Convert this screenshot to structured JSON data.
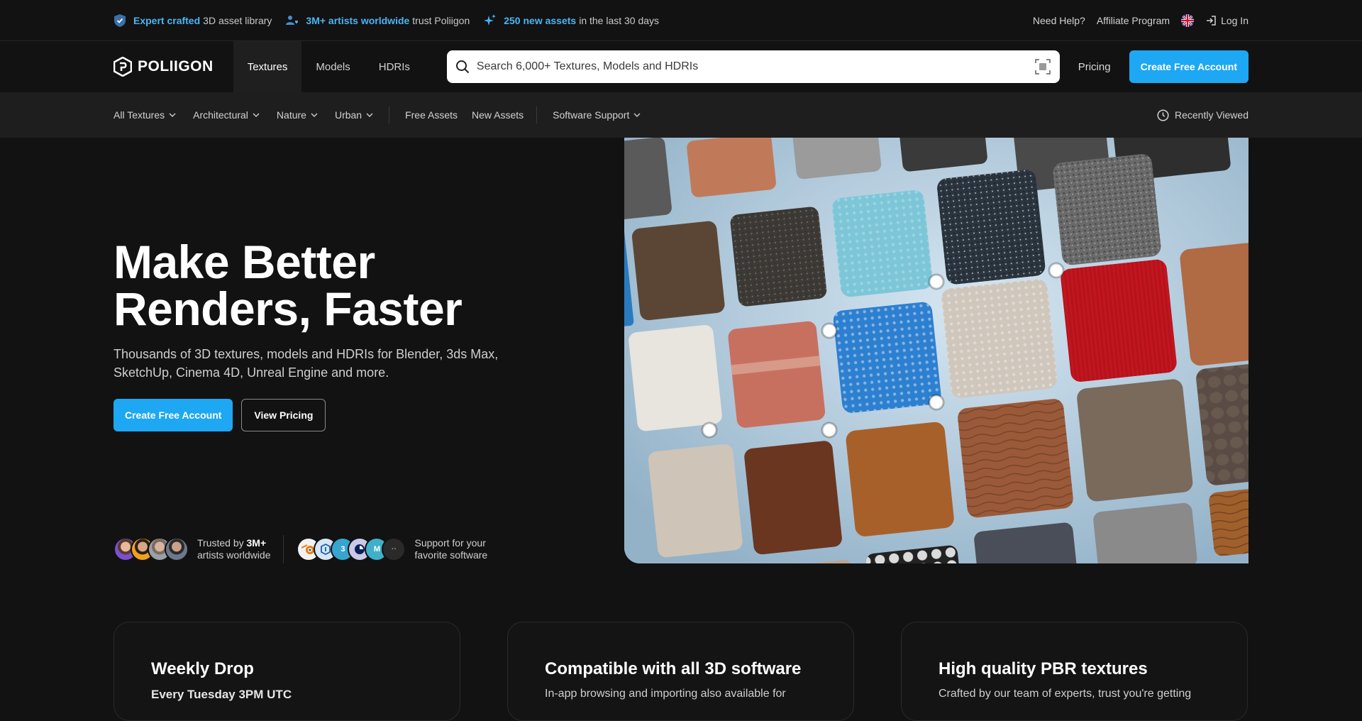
{
  "topbar": {
    "item1_hl": "Expert crafted",
    "item1_text": "3D asset library",
    "item2_hl": "3M+ artists worldwide",
    "item2_text": "trust Poliigon",
    "item3_hl": "250 new assets",
    "item3_text": "in the last 30 days",
    "help": "Need Help?",
    "affiliate": "Affiliate Program",
    "login": "Log In"
  },
  "header": {
    "logo": "POLIIGON",
    "tabs": [
      "Textures",
      "Models",
      "HDRIs"
    ],
    "search_placeholder": "Search 6,000+ Textures, Models and HDRIs",
    "pricing": "Pricing",
    "cta": "Create Free Account"
  },
  "catbar": {
    "dropdowns": [
      "All Textures",
      "Architectural",
      "Nature",
      "Urban"
    ],
    "links": [
      "Free Assets",
      "New Assets"
    ],
    "software": "Software Support",
    "recent": "Recently Viewed"
  },
  "hero": {
    "title_line1": "Make Better",
    "title_line2": "Renders, Faster",
    "subtitle": "Thousands of 3D textures, models and HDRIs for Blender, 3ds Max, SketchUp, Cinema 4D, Unreal Engine and more.",
    "cta_primary": "Create Free Account",
    "cta_secondary": "View Pricing",
    "trust_prefix": "Trusted by",
    "trust_count": "3M+",
    "trust_suffix": "artists worldwide",
    "support_line1": "Support for your",
    "support_line2": "favorite software",
    "software_badges": [
      "3",
      "M",
      "··"
    ]
  },
  "cards": [
    {
      "title": "Weekly Drop",
      "text": "Every Tuesday 3PM UTC"
    },
    {
      "title": "Compatible with all 3D software",
      "text": "In-app browsing and importing also available for"
    },
    {
      "title": "High quality PBR textures",
      "text": "Crafted by our team of experts, trust you're getting"
    }
  ],
  "colors": {
    "accent": "#1ea7f3",
    "highlight": "#4ab5f5",
    "bg": "#121212",
    "catbar": "#1e1e1e"
  }
}
